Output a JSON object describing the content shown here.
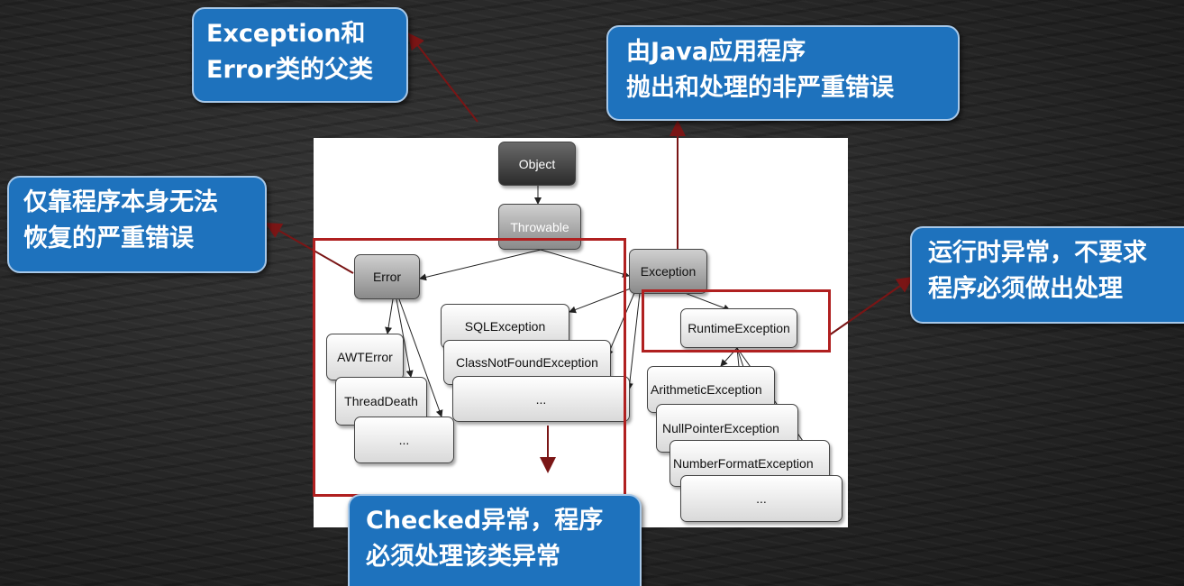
{
  "callouts": {
    "parent": {
      "line1": "Exception和",
      "line2": "Error类的父类"
    },
    "java_app": {
      "line1": "由Java应用程序",
      "line2": "抛出和处理的非严重错误"
    },
    "error": {
      "line1": "仅靠程序本身无法",
      "line2": "恢复的严重错误"
    },
    "runtime": {
      "line1": "运行时异常，不要求",
      "line2": "程序必须做出处理"
    },
    "checked": {
      "line1": "Checked异常，程序",
      "line2": "必须处理该类异常"
    }
  },
  "nodes": {
    "object": "Object",
    "throwable": "Throwable",
    "error": "Error",
    "exception": "Exception",
    "awt_error": "AWTError",
    "thread_death": "ThreadDeath",
    "error_more": "...",
    "sql_exception": "SQLException",
    "class_not_found": "ClassNotFoundException",
    "checked_more": "...",
    "runtime_exception": "RuntimeException",
    "arithmetic": "ArithmeticException",
    "null_pointer": "NullPointerException",
    "number_format": "NumberFormatException",
    "runtime_more": "..."
  },
  "colors": {
    "callout_bg": "#1e72bd",
    "frame": "#b02020",
    "connector": "#7a1515"
  }
}
